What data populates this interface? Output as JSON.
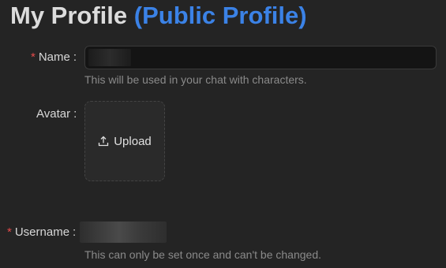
{
  "header": {
    "title": "My Profile",
    "subtitle": "(Public Profile)"
  },
  "form": {
    "name": {
      "label": "Name",
      "required_mark": "*",
      "value": "",
      "help": "This will be used in your chat with characters."
    },
    "avatar": {
      "label": "Avatar",
      "upload_label": "Upload",
      "upload_icon": "upload-icon"
    },
    "username": {
      "label": "Username",
      "required_mark": "*",
      "help": "This can only be set once and can't be changed."
    },
    "colon": ":"
  },
  "colors": {
    "accent": "#3b82e6",
    "required": "#e34a4a",
    "background": "#242424"
  }
}
